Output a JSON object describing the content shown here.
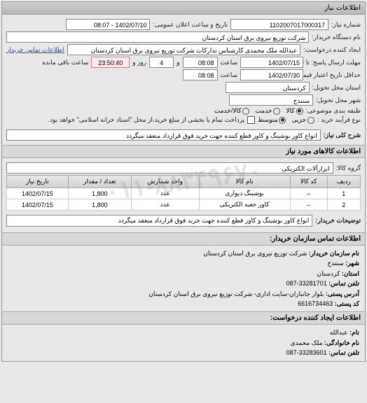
{
  "header": "اطلاعات نیاز",
  "fields": {
    "number_label": "شماره نیاز:",
    "number": "1102007017000317",
    "pubdate_label": "تاریخ و ساعت اعلان عمومی:",
    "pubdate": "1402/07/10 - 08:07",
    "buyer_label": "نام دستگاه خریدار:",
    "buyer": "شرکت توزیع نیروی برق استان کردستان",
    "requester_label": "ایجاد کننده درخواست:",
    "requester": "عبدالله ملک محمدی کارشناس تدارکات شرکت توزیع نیروی برق استان کردستان",
    "contact_link": "اطلاعات تماس خریدار",
    "deadline_send_label": "مهلت ارسال پاسخ: تا تاریخ:",
    "deadline_send_date": "1402/07/15",
    "deadline_send_time_label": "ساعت",
    "deadline_send_time": "08:08",
    "days_label": "و",
    "days": "4",
    "days_after": "روز و",
    "remain": "23:50:40",
    "remain_after": "ساعت باقی مانده",
    "price_validity_label": "حداقل تاریخ اعتبار قیمت: تا تاریخ:",
    "price_validity_date": "1402/07/30",
    "price_validity_time": "08:08",
    "province_label": "استان محل تحویل:",
    "province": "کردستان",
    "city_label": "شهر محل تحویل:",
    "city": "سنندج",
    "catgroup_label": "طبقه بندی موضوعی:",
    "cat_goods": "کالا",
    "cat_service": "خدمت",
    "cat_goodservice": "کالا/خدمت",
    "process_label": "نوع فرآیند خرید :",
    "proc_minor": "جزیی",
    "proc_med": "متوسط",
    "proc_note": "پرداخت تمام یا بخشی از مبلغ خرید،از محل \"اسناد خزانه اسلامی\" خواهد بود.",
    "need_title_label": "شرح کلی نیاز:",
    "need_title": "انواع کاور بوشینگ و کاور قطع کننده جهت خرید فوق قرارداد منعقد میگردد"
  },
  "goods_section": "اطلاعات کالاهای مورد نیاز",
  "goods_group_label": "گروه کالا:",
  "goods_group": "ابزارآلات الکتریکی",
  "table": {
    "headers": [
      "ردیف",
      "کد کالا",
      "نام کالا",
      "واحد شمارش",
      "تعداد / مقدار",
      "تاریخ نیاز"
    ],
    "rows": [
      {
        "n": "1",
        "code": "--",
        "name": "بوشینگ دیواری",
        "unit": "عدد",
        "qty": "1,800",
        "date": "1402/07/15"
      },
      {
        "n": "2",
        "code": "--",
        "name": "کاور جعبه الکتریکی",
        "unit": "عدد",
        "qty": "1,800",
        "date": "1402/07/15"
      }
    ]
  },
  "buyer_desc_label": "توضیحات خریدار:",
  "buyer_desc": "انواع کاور بوشینگ و کاور قطع کننده جهت خرید فوق قرارداد منعقد میگردد",
  "contact_header": "اطلاعات تماس سازمان خریدار:",
  "contact": {
    "org_label": "نام سازمان خریدار:",
    "org": "شرکت توزیع نیروی برق استان کردستان",
    "city_label": "شهر:",
    "city": "سنندج",
    "province_label": "استان:",
    "province": "کردستان",
    "phone_label": "تلفن تماس:",
    "phone": "33281701-087",
    "address_label": "آدرس پستی:",
    "address": "بلوار جانبازان-سایت اداری- شرکت توزیع نیروی برق استان کردستان",
    "postal_label": "کد پستی:",
    "postal": "6616734463"
  },
  "creator_header": "اطلاعات ایجاد کننده درخواست:",
  "creator": {
    "fname_label": "نام:",
    "fname": "عبدالله",
    "lname_label": "نام خانوادگی:",
    "lname": "ملک محمدی",
    "phone_label": "تلفن تماس:",
    "phone": "33283601-087"
  },
  "watermark": "۰۱۱-۸۸۳۴۹۶۷۰"
}
